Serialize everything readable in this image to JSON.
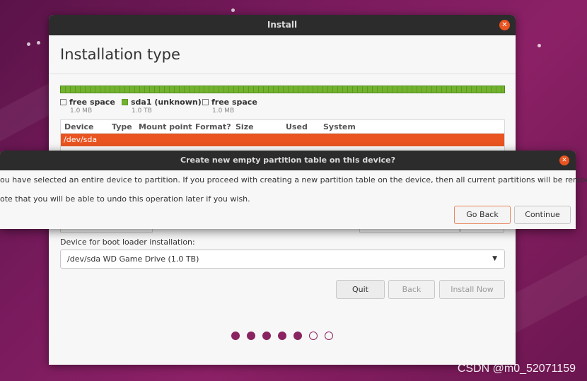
{
  "window": {
    "title": "Install",
    "page_title": "Installation type"
  },
  "partitions": {
    "legend": [
      {
        "name": "free space",
        "size": "1.0 MB",
        "kind": "free"
      },
      {
        "name": "sda1 (unknown)",
        "size": "1.0 TB",
        "kind": "used"
      },
      {
        "name": "free space",
        "size": "1.0 MB",
        "kind": "free"
      }
    ],
    "columns": [
      "Device",
      "Type",
      "Mount point",
      "Format?",
      "Size",
      "Used",
      "System"
    ],
    "rows": [
      {
        "device": "/dev/sda",
        "selected": true
      }
    ]
  },
  "bootloader": {
    "label": "Device for boot loader installation:",
    "selected": "/dev/sda WD Game Drive (1.0 TB)"
  },
  "buttons": {
    "quit": "Quit",
    "back": "Back",
    "install_now": "Install Now"
  },
  "progress": {
    "total_steps": 7,
    "completed_steps": 5
  },
  "dialog": {
    "title": "Create new empty partition table on this device?",
    "line1": "ou have selected an entire device to partition. If you proceed with creating a new partition table on the device, then all current partitions will be removed.",
    "line2": "ote that you will be able to undo this operation later if you wish.",
    "go_back": "Go Back",
    "continue": "Continue"
  },
  "watermark": "CSDN @m0_52071159",
  "colors": {
    "accent": "#e95420",
    "partition_green": "#73b22f",
    "progress_dot": "#8a2460",
    "titlebar": "#2c2c2c"
  }
}
